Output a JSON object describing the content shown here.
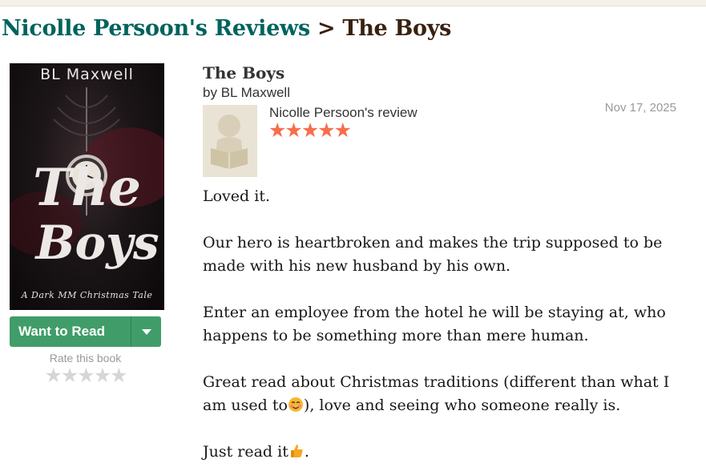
{
  "header": {
    "reviews_link": "Nicolle Persoon's Reviews",
    "separator": ">",
    "book_title": "The Boys"
  },
  "cover": {
    "author": "BL Maxwell",
    "title_line1": "The",
    "title_line2": "Boys",
    "subtitle": "A Dark MM Christmas Tale"
  },
  "shelf_button": {
    "label": "Want to Read",
    "dropdown_icon": "caret-down-icon"
  },
  "rate": {
    "label": "Rate this book",
    "stars": [
      "★",
      "★",
      "★",
      "★",
      "★"
    ],
    "rating": 0
  },
  "book": {
    "title": "The Boys",
    "by": "by",
    "author": "BL Maxwell"
  },
  "review": {
    "reviewer": "Nicolle Persoon's review",
    "stars": "★★★★★",
    "rating": 5,
    "date": "Nov 17, 2025",
    "paragraphs": {
      "p1": "Loved it.",
      "p2": "Our hero is heartbroken and makes the trip supposed to be made with his new husband by his own.",
      "p3": "Enter an employee from the hotel he will be staying at, who happens to be something more than mere human.",
      "p4a": "Great read about Christmas traditions (different than what I am used to",
      "p4b": "), love and seeing who someone really is.",
      "p5a": "Just read it",
      "p5b": "."
    }
  },
  "colors": {
    "link_green": "#00635d",
    "heading_brown": "#382110",
    "button_green": "#409d69",
    "star_orange": "#f76d4d",
    "star_empty": "#d6d6d6"
  }
}
